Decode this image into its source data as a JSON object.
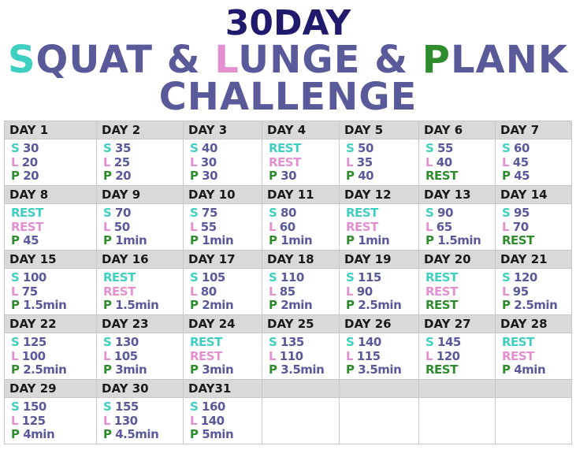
{
  "title": {
    "line1": "30DAY",
    "line2": {
      "s_letter": "S",
      "s_rest": "QUAT & ",
      "l_letter": "L",
      "l_rest": "UNGE & ",
      "p_letter": "P",
      "p_rest": "LANK"
    },
    "line3": "CHALLENGE"
  },
  "colors": {
    "squat": "#3fcfc0",
    "lunge": "#e48fd0",
    "plank": "#2e8b2e",
    "value": "#5a5a9a",
    "title_dark": "#1f1a6b"
  },
  "days": [
    {
      "label": "DAY 1",
      "s": "30",
      "l": "20",
      "p": "20"
    },
    {
      "label": "DAY 2",
      "s": "35",
      "l": "25",
      "p": "20"
    },
    {
      "label": "DAY 3",
      "s": "40",
      "l": "30",
      "p": "30"
    },
    {
      "label": "DAY 4",
      "s": "REST",
      "l": "REST",
      "p": "30"
    },
    {
      "label": "DAY 5",
      "s": "50",
      "l": "35",
      "p": "40"
    },
    {
      "label": "DAY 6",
      "s": "55",
      "l": "40",
      "p": "REST"
    },
    {
      "label": "DAY 7",
      "s": "60",
      "l": "45",
      "p": "45"
    },
    {
      "label": "DAY 8",
      "s": "REST",
      "l": "REST",
      "p": "45"
    },
    {
      "label": "DAY 9",
      "s": "70",
      "l": "50",
      "p": "1min"
    },
    {
      "label": "DAY 10",
      "s": "75",
      "l": "55",
      "p": "1min"
    },
    {
      "label": "DAY 11",
      "s": "80",
      "l": "60",
      "p": "1min"
    },
    {
      "label": "DAY 12",
      "s": "REST",
      "l": "REST",
      "p": "1min"
    },
    {
      "label": "DAY 13",
      "s": "90",
      "l": "65",
      "p": "1.5min"
    },
    {
      "label": "DAY 14",
      "s": "95",
      "l": "70",
      "p": "REST"
    },
    {
      "label": "DAY 15",
      "s": "100",
      "l": "75",
      "p": "1.5min"
    },
    {
      "label": "DAY 16",
      "s": "REST",
      "l": "REST",
      "p": "1.5min"
    },
    {
      "label": "DAY 17",
      "s": "105",
      "l": "80",
      "p": "2min"
    },
    {
      "label": "DAY 18",
      "s": "110",
      "l": "85",
      "p": "2min"
    },
    {
      "label": "DAY 19",
      "s": "115",
      "l": "90",
      "p": "2.5min"
    },
    {
      "label": "DAY 20",
      "s": "REST",
      "l": "REST",
      "p": "REST"
    },
    {
      "label": "DAY 21",
      "s": "120",
      "l": "95",
      "p": "2.5min"
    },
    {
      "label": "DAY 22",
      "s": "125",
      "l": "100",
      "p": "2.5min"
    },
    {
      "label": "DAY 23",
      "s": "130",
      "l": "105",
      "p": "3min"
    },
    {
      "label": "DAY 24",
      "s": "REST",
      "l": "REST",
      "p": "3min"
    },
    {
      "label": "DAY 25",
      "s": "135",
      "l": "110",
      "p": "3.5min"
    },
    {
      "label": "DAY 26",
      "s": "140",
      "l": "115",
      "p": "3.5min"
    },
    {
      "label": "DAY 27",
      "s": "145",
      "l": "120",
      "p": "REST"
    },
    {
      "label": "DAY 28",
      "s": "REST",
      "l": "REST",
      "p": "4min"
    },
    {
      "label": "DAY 29",
      "s": "150",
      "l": "125",
      "p": "4min"
    },
    {
      "label": "DAY 30",
      "s": "155",
      "l": "130",
      "p": "4.5min"
    },
    {
      "label": "DAY31",
      "s": "160",
      "l": "140",
      "p": "5min"
    }
  ],
  "letters": {
    "s": "S",
    "l": "L",
    "p": "P"
  }
}
